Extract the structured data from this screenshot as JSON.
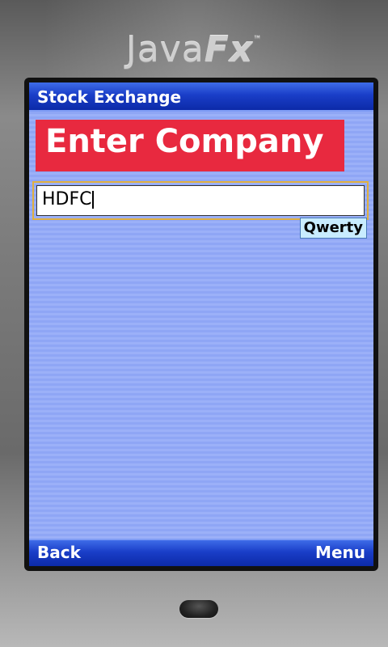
{
  "device": {
    "brand_main": "Java",
    "brand_fx": "Fx",
    "brand_tm": "™"
  },
  "app": {
    "title": "Stock Exchange"
  },
  "form": {
    "heading": "Enter Company",
    "company_value": "HDFC",
    "input_mode": "Qwerty"
  },
  "softkeys": {
    "left": "Back",
    "right": "Menu"
  },
  "colors": {
    "titlebar": "#1a3ec8",
    "heading_bg": "#e8293f",
    "screen_bg": "#8fa6f5",
    "ime_bg": "#c8ecff"
  },
  "icons": {
    "home": "home-key"
  }
}
